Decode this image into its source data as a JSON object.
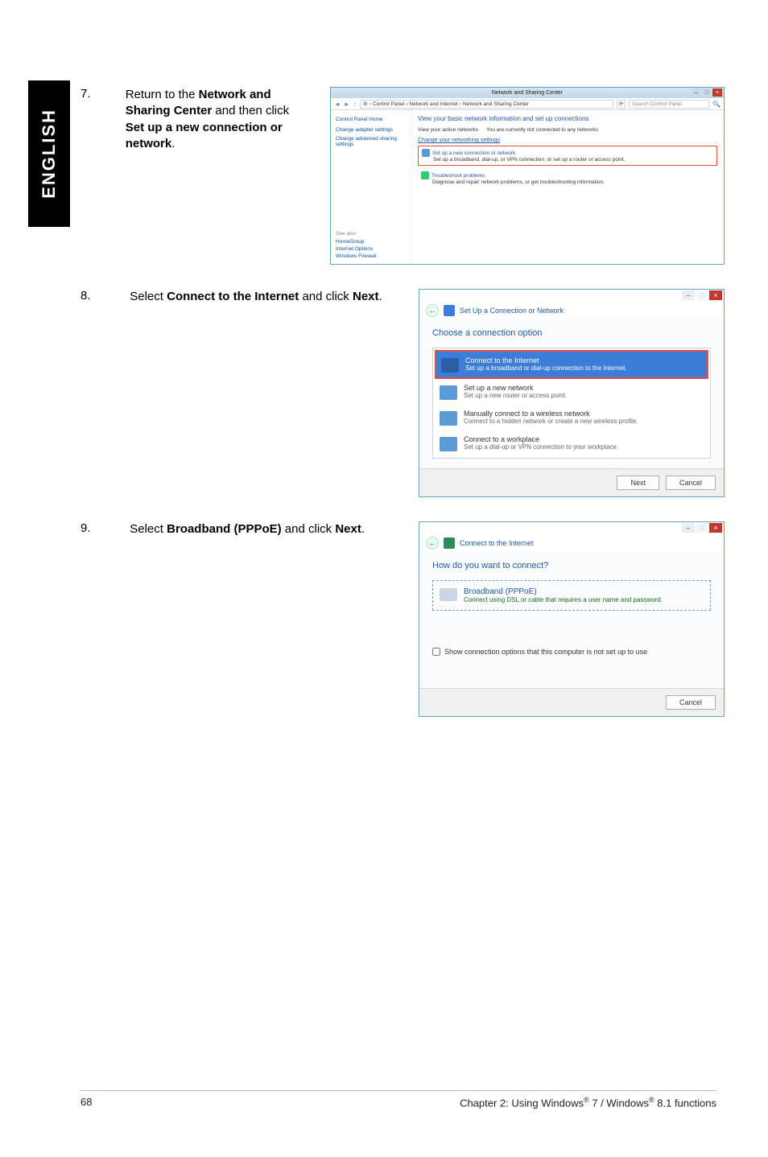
{
  "side_tab": "ENGLISH",
  "steps": {
    "s7": {
      "num": "7.",
      "text_parts": [
        "Return to the ",
        "Network and Sharing Center",
        " and then click ",
        "Set up a new connection or network",
        "."
      ]
    },
    "s8": {
      "num": "8.",
      "text_parts": [
        "Select ",
        "Connect to the Internet",
        " and click ",
        "Next",
        "."
      ]
    },
    "s9": {
      "num": "9.",
      "text_parts": [
        "Select ",
        "Broadband (PPPoE)",
        " and click ",
        "Next",
        "."
      ]
    }
  },
  "fig7": {
    "window_title": "Network and Sharing Center",
    "breadcrumb": [
      "Control Panel",
      "Network and Internet",
      "Network and Sharing Center"
    ],
    "search_placeholder": "Search Control Panel",
    "left": {
      "home": "Control Panel Home",
      "links": [
        "Change adapter settings",
        "Change advanced sharing settings"
      ],
      "see_also_h": "See also",
      "see_also": [
        "HomeGroup",
        "Internet Options",
        "Windows Firewall"
      ]
    },
    "right": {
      "heading": "View your basic network information and set up connections",
      "active_label": "View your active networks",
      "active_text": "You are currently not connected to any networks.",
      "change_h": "Change your networking settings",
      "item1_t": "Set up a new connection or network",
      "item1_d": "Set up a broadband, dial-up, or VPN connection; or set up a router or access point.",
      "item2_t": "Troubleshoot problems",
      "item2_d": "Diagnose and repair network problems, or get troubleshooting information."
    }
  },
  "fig8": {
    "crumb_title": "Set Up a Connection or Network",
    "panel_title": "Choose a connection option",
    "options": [
      {
        "l1": "Connect to the Internet",
        "l2": "Set up a broadband or dial-up connection to the Internet."
      },
      {
        "l1": "Set up a new network",
        "l2": "Set up a new router or access point."
      },
      {
        "l1": "Manually connect to a wireless network",
        "l2": "Connect to a hidden network or create a new wireless profile."
      },
      {
        "l1": "Connect to a workplace",
        "l2": "Set up a dial-up or VPN connection to your workplace."
      }
    ],
    "btn_next": "Next",
    "btn_cancel": "Cancel"
  },
  "fig9": {
    "crumb_title": "Connect to the Internet",
    "panel_title": "How do you want to connect?",
    "opt_l1": "Broadband (PPPoE)",
    "opt_l2": "Connect using DSL or cable that requires a user name and password.",
    "chk_label": "Show connection options that this computer is not set up to use",
    "btn_cancel": "Cancel"
  },
  "footer": {
    "page_num": "68",
    "chapter_prefix": "Chapter 2: Using Windows",
    "reg": "®",
    "seven": " 7 / Windows",
    "eight": " 8.1 functions"
  }
}
